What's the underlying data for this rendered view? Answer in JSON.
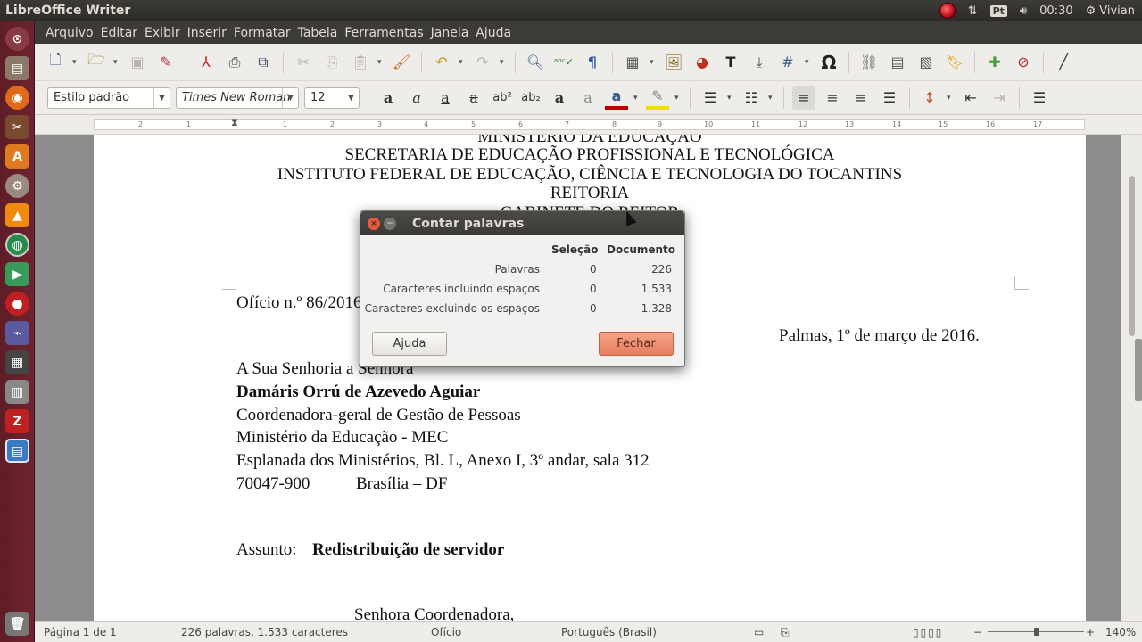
{
  "window": {
    "app_title": "LibreOffice Writer"
  },
  "panel": {
    "lang_code": "Pt",
    "clock": "00:30",
    "user": "Vivian"
  },
  "menu": [
    "Arquivo",
    "Editar",
    "Exibir",
    "Inserir",
    "Formatar",
    "Tabela",
    "Ferramentas",
    "Janela",
    "Ajuda"
  ],
  "formatting": {
    "paragraph_style": "Estilo padrão",
    "font_name": "Times New Roman",
    "font_size": "12"
  },
  "ruler_ticks": [
    "2",
    "1",
    "1",
    "2",
    "3",
    "4",
    "5",
    "6",
    "7",
    "8",
    "9",
    "10",
    "11",
    "12",
    "13",
    "14",
    "15",
    "16",
    "17"
  ],
  "document": {
    "header_lines": [
      "MINISTÉRIO DA EDUCAÇÃO",
      "SECRETARIA DE EDUCAÇÃO PROFISSIONAL E TECNOLÓGICA",
      "INSTITUTO FEDERAL DE EDUCAÇÃO, CIÊNCIA E TECNOLOGIA DO TOCANTINS",
      "REITORIA",
      "GABINETE DO REITOR"
    ],
    "oficio": "Ofício n.º 86/2016",
    "date_line": "Palmas, 1º de março de 2016.",
    "address_intro": "A Sua Senhoria a Senhora",
    "recipient_name": "Damáris Orrú de Azevedo Aguiar",
    "recipient_lines": [
      "Coordenadora-geral de Gestão de Pessoas",
      "Ministério da Educação - MEC",
      "Esplanada dos Ministérios, Bl. L, Anexo I, 3º andar, sala 312"
    ],
    "postal_code": "70047-900",
    "city": "Brasília – DF",
    "subject_label": "Assunto:",
    "subject": "Redistribuição de servidor",
    "salutation": "Senhora Coordenadora,"
  },
  "dialog": {
    "title": "Contar palavras",
    "col_selection": "Seleção",
    "col_document": "Documento",
    "rows": [
      {
        "label": "Palavras",
        "selection": "0",
        "document": "226"
      },
      {
        "label": "Caracteres incluindo espaços",
        "selection": "0",
        "document": "1.533"
      },
      {
        "label": "Caracteres excluindo os espaços",
        "selection": "0",
        "document": "1.328"
      }
    ],
    "help_button": "Ajuda",
    "close_button": "Fechar"
  },
  "status": {
    "page": "Página 1 de 1",
    "counts": "226 palavras, 1.533 caracteres",
    "style": "Ofício",
    "language": "Português (Brasil)",
    "zoom": "140%"
  },
  "colors": {
    "launcher_bg": "#6e2430",
    "panel_bg": "#3c3b37",
    "close_button_bg": "#ef8f70",
    "dialog_title_bg": "#3c3b37"
  }
}
